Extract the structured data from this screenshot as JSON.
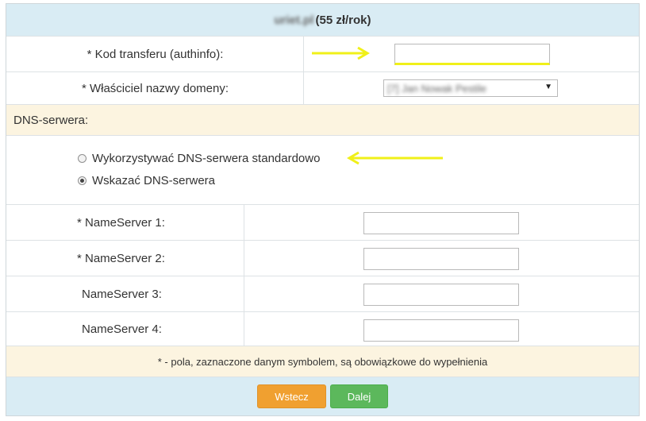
{
  "header": {
    "domain_name_blurred": "uriet.pl",
    "price": "(55 zł/rok)"
  },
  "form": {
    "transfer_code_label": "* Kod transferu (authinfo):",
    "transfer_code_value": "",
    "owner_label": "* Właściciel nazwy domeny:",
    "owner_value_blurred": "[7] Jan Nowak Pestile"
  },
  "dns": {
    "section_title": "DNS-serwera:",
    "options": [
      {
        "label": "Wykorzystywać DNS-serwera standardowo",
        "selected": false
      },
      {
        "label": "Wskazać DNS-serwera",
        "selected": true
      }
    ],
    "nameservers": [
      {
        "label": "* NameServer 1:",
        "value": ""
      },
      {
        "label": "* NameServer 2:",
        "value": ""
      },
      {
        "label": "NameServer 3:",
        "value": ""
      },
      {
        "label": "NameServer 4:",
        "value": ""
      }
    ]
  },
  "footnote": "* - pola, zaznaczone danym symbolem, są obowiązkowe do wypełnienia",
  "buttons": {
    "back": "Wstecz",
    "next": "Dalej"
  },
  "colors": {
    "header_bg": "#d9ecf4",
    "section_bg": "#fcf4e0",
    "annotation": "#f0f019",
    "back_button": "#f0a030",
    "next_button": "#5cb85c"
  }
}
